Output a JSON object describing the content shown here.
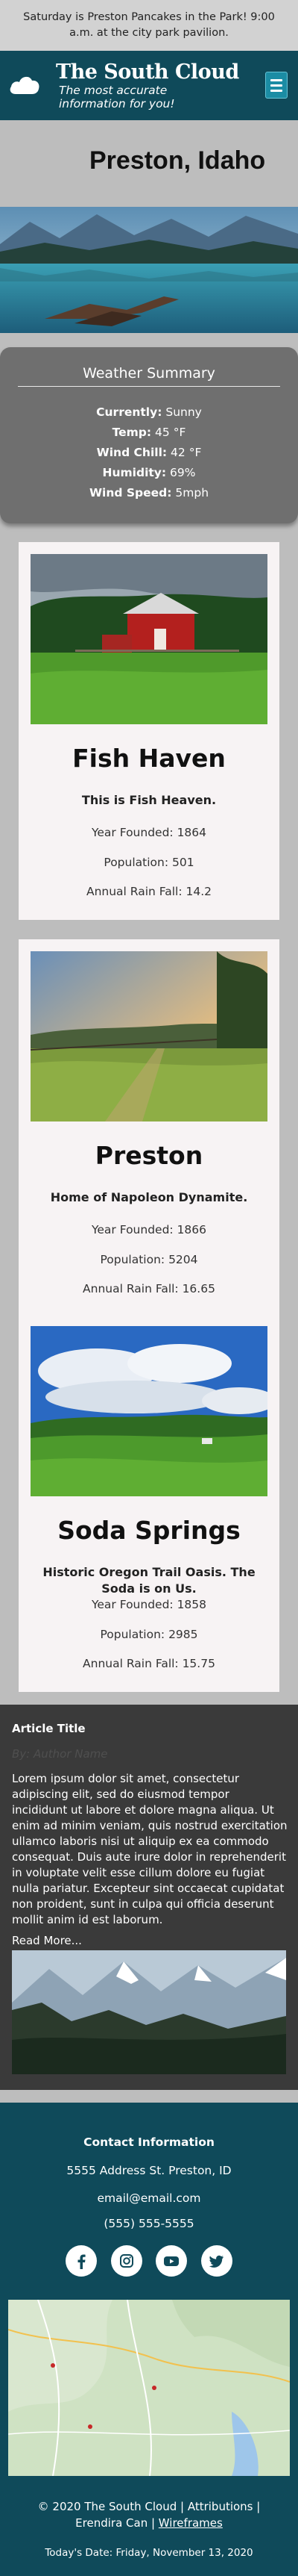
{
  "banner": {
    "text": "Saturday is Preston Pancakes in the Park! 9:00 a.m. at the city park pavilion."
  },
  "header": {
    "title": "The South Cloud",
    "tagline_1": "The most accurate",
    "tagline_2": "information for you!",
    "logo_icon": "cloud-icon",
    "menu_icon": "hamburger-menu-icon"
  },
  "city": {
    "name": "Preston, Idaho"
  },
  "weather": {
    "title": "Weather Summary",
    "currently_label": "Currently:",
    "currently_value": "Sunny",
    "temp_label": "Temp:",
    "temp_value": "45 °F",
    "wind_chill_label": "Wind Chill:",
    "wind_chill_value": "42 °F",
    "humidity_label": "Humidity:",
    "humidity_value": "69%",
    "wind_speed_label": "Wind Speed:",
    "wind_speed_value": "5mph"
  },
  "towns": [
    {
      "name": "Fish Haven",
      "motto": "This is Fish Heaven.",
      "founded": "Year Founded: 1864",
      "population": "Population: 501",
      "rain": "Annual Rain Fall: 14.2"
    },
    {
      "name": "Preston",
      "motto": "Home of Napoleon Dynamite.",
      "founded": "Year Founded: 1866",
      "population": "Population: 5204",
      "rain": "Annual Rain Fall: 16.65"
    },
    {
      "name": "Soda Springs",
      "motto": "Historic Oregon Trail Oasis. The Soda is on Us.",
      "founded": "Year Founded: 1858",
      "population": "Population: 2985",
      "rain": "Annual Rain Fall: 15.75"
    }
  ],
  "article": {
    "title": "Article Title",
    "author": "By: Author Name",
    "body": "Lorem ipsum dolor sit amet, consectetur adipiscing elit, sed do eiusmod tempor incididunt ut labore et dolore magna aliqua. Ut enim ad minim veniam, quis nostrud exercitation ullamco laboris nisi ut aliquip ex ea commodo consequat. Duis aute irure dolor in reprehenderit in voluptate velit esse cillum dolore eu fugiat nulla pariatur. Excepteur sint occaecat cupidatat non proident, sunt in culpa qui officia deserunt mollit anim id est laborum.",
    "read_more": "Read More..."
  },
  "footer": {
    "contact_heading": "Contact Information",
    "address": "5555 Address St. Preston, ID",
    "email": "email@email.com",
    "phone": "(555) 555-5555",
    "social_icons": [
      "facebook-icon",
      "instagram-icon",
      "youtube-icon",
      "twitter-icon"
    ],
    "copyright_1": "© 2020 The South Cloud | Attributions |",
    "copyright_2": "Erendira Can | ",
    "wireframes": "Wireframes",
    "today": "Today's Date: Friday, November 13, 2020"
  }
}
